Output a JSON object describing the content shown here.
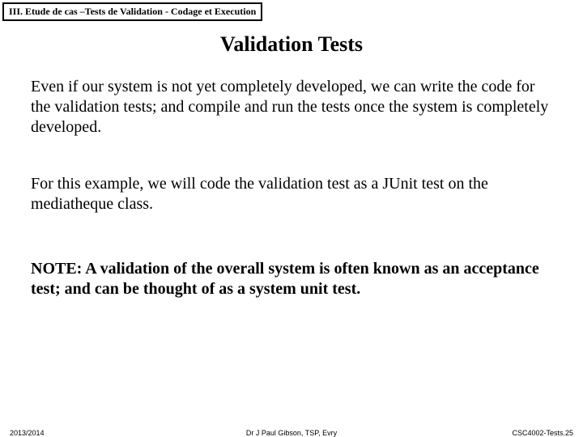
{
  "header": {
    "section_label": "III. Etude de cas –Tests de Validation - Codage et Execution"
  },
  "title": "Validation Tests",
  "paragraphs": {
    "p1": "Even if our system is not yet completely developed, we can write the code for the validation tests; and compile and run the tests once the system is completely developed.",
    "p2": "For this example, we will code the validation test as a JUnit test on the mediatheque class.",
    "p3": "NOTE: A validation of the overall system is often known as an acceptance test; and can be thought of as a system unit test."
  },
  "footer": {
    "left": "2013/2014",
    "center": "Dr J Paul Gibson, TSP, Evry",
    "right": "CSC4002-Tests.25"
  }
}
